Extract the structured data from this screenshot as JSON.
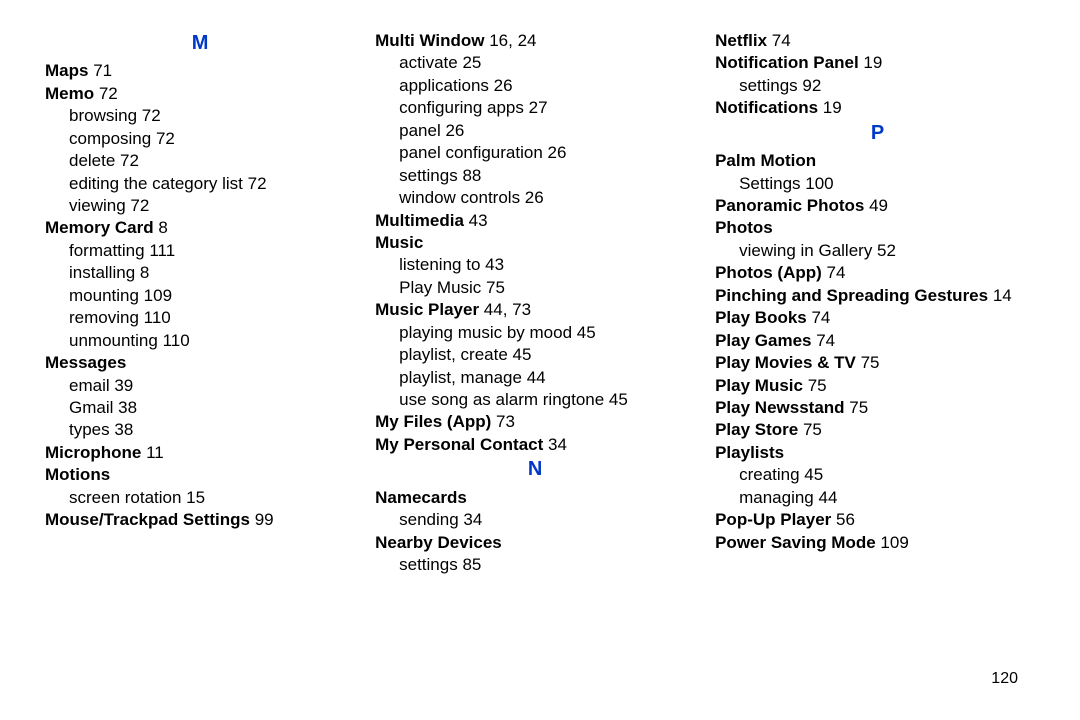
{
  "page_number": "120",
  "columns": [
    {
      "letters": [
        {
          "letter": "M",
          "entries": [
            {
              "label": "Maps",
              "pages": "71"
            },
            {
              "label": "Memo",
              "pages": "72",
              "subs": [
                {
                  "label": "browsing",
                  "pages": "72"
                },
                {
                  "label": "composing",
                  "pages": "72"
                },
                {
                  "label": "delete",
                  "pages": "72"
                },
                {
                  "label": "editing the category list",
                  "pages": "72"
                },
                {
                  "label": "viewing",
                  "pages": "72"
                }
              ]
            },
            {
              "label": "Memory Card",
              "pages": "8",
              "subs": [
                {
                  "label": "formatting",
                  "pages": "111"
                },
                {
                  "label": "installing",
                  "pages": "8"
                },
                {
                  "label": "mounting",
                  "pages": "109"
                },
                {
                  "label": "removing",
                  "pages": "110"
                },
                {
                  "label": "unmounting",
                  "pages": "110"
                }
              ]
            },
            {
              "label": "Messages",
              "pages": "",
              "subs": [
                {
                  "label": "email",
                  "pages": "39"
                },
                {
                  "label": "Gmail",
                  "pages": "38"
                },
                {
                  "label": "types",
                  "pages": "38"
                }
              ]
            },
            {
              "label": "Microphone",
              "pages": "11"
            },
            {
              "label": "Motions",
              "pages": "",
              "subs": [
                {
                  "label": "screen rotation",
                  "pages": "15"
                }
              ]
            },
            {
              "label": "Mouse/Trackpad Settings",
              "pages": "99"
            }
          ]
        }
      ]
    },
    {
      "letters": [
        {
          "letter": "",
          "entries": [
            {
              "label": "Multi Window",
              "pages": "16, 24",
              "subs": [
                {
                  "label": "activate",
                  "pages": "25"
                },
                {
                  "label": "applications",
                  "pages": "26"
                },
                {
                  "label": "configuring apps",
                  "pages": "27"
                },
                {
                  "label": "panel",
                  "pages": "26"
                },
                {
                  "label": "panel configuration",
                  "pages": "26"
                },
                {
                  "label": "settings",
                  "pages": "88"
                },
                {
                  "label": "window controls",
                  "pages": "26"
                }
              ]
            },
            {
              "label": "Multimedia",
              "pages": "43"
            },
            {
              "label": "Music",
              "pages": "",
              "subs": [
                {
                  "label": "listening to",
                  "pages": "43"
                },
                {
                  "label": "Play Music",
                  "pages": "75"
                }
              ]
            },
            {
              "label": "Music Player",
              "pages": "44, 73",
              "subs": [
                {
                  "label": "playing music by mood",
                  "pages": "45"
                },
                {
                  "label": "playlist, create",
                  "pages": "45"
                },
                {
                  "label": "playlist, manage",
                  "pages": "44"
                },
                {
                  "label": "use song as alarm ringtone",
                  "pages": "45"
                }
              ]
            },
            {
              "label": "My Files (App)",
              "pages": "73"
            },
            {
              "label": "My Personal Contact",
              "pages": "34"
            }
          ]
        },
        {
          "letter": "N",
          "entries": [
            {
              "label": "Namecards",
              "pages": "",
              "subs": [
                {
                  "label": "sending",
                  "pages": "34"
                }
              ]
            },
            {
              "label": "Nearby Devices",
              "pages": "",
              "subs": [
                {
                  "label": "settings",
                  "pages": "85"
                }
              ]
            }
          ]
        }
      ]
    },
    {
      "letters": [
        {
          "letter": "",
          "entries": [
            {
              "label": "Netflix",
              "pages": "74"
            },
            {
              "label": "Notification Panel",
              "pages": "19",
              "subs": [
                {
                  "label": "settings",
                  "pages": "92"
                }
              ]
            },
            {
              "label": "Notifications",
              "pages": "19"
            }
          ]
        },
        {
          "letter": "P",
          "entries": [
            {
              "label": "Palm Motion",
              "pages": "",
              "subs": [
                {
                  "label": "Settings",
                  "pages": "100"
                }
              ]
            },
            {
              "label": "Panoramic Photos",
              "pages": "49"
            },
            {
              "label": "Photos",
              "pages": "",
              "subs": [
                {
                  "label": "viewing in Gallery",
                  "pages": "52"
                }
              ]
            },
            {
              "label": "Photos (App)",
              "pages": "74"
            },
            {
              "label": "Pinching and Spreading Gestures",
              "pages": "14"
            },
            {
              "label": "Play Books",
              "pages": "74"
            },
            {
              "label": "Play Games",
              "pages": "74"
            },
            {
              "label": "Play Movies & TV",
              "pages": "75"
            },
            {
              "label": "Play Music",
              "pages": "75"
            },
            {
              "label": "Play Newsstand",
              "pages": "75"
            },
            {
              "label": "Play Store",
              "pages": "75"
            },
            {
              "label": "Playlists",
              "pages": "",
              "subs": [
                {
                  "label": "creating",
                  "pages": "45"
                },
                {
                  "label": "managing",
                  "pages": "44"
                }
              ]
            },
            {
              "label": "Pop-Up Player",
              "pages": "56"
            },
            {
              "label": "Power Saving Mode",
              "pages": "109"
            }
          ]
        }
      ]
    }
  ]
}
